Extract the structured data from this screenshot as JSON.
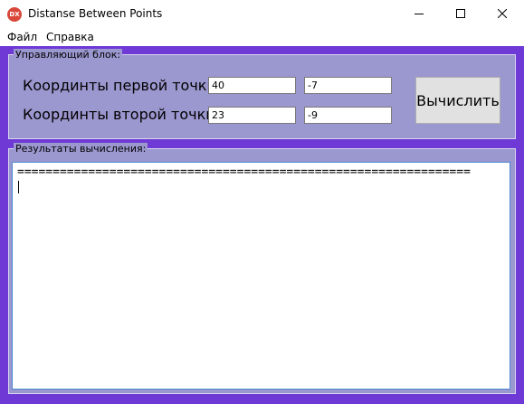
{
  "window": {
    "title": "Distanse Between Points",
    "app_icon_text": "DX"
  },
  "menu": {
    "items": [
      {
        "label": "Файл"
      },
      {
        "label": "Справка"
      }
    ]
  },
  "control_group": {
    "title": "Управляющий блок:",
    "first_point_label": "Координты первой точки:",
    "second_point_label": "Координты второй точки:",
    "first_point_x": "40",
    "first_point_y": "-7",
    "second_point_x": "23",
    "second_point_y": "-9",
    "calculate_label": "Вычислить"
  },
  "results_group": {
    "title": "Результаты вычисления:",
    "output_text": "================================================================"
  },
  "colors": {
    "client_background": "#6f39d6",
    "group_background": "#9b97cf",
    "textarea_border": "#4a86d4",
    "app_icon": "#d9473b"
  }
}
